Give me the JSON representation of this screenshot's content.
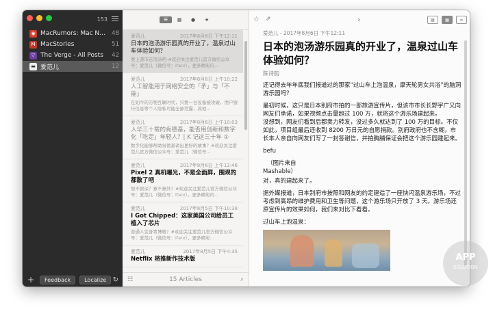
{
  "sidebar": {
    "total_count": "153",
    "feeds": [
      {
        "name": "MacRumors: Mac News a...",
        "count": "48",
        "icon_color": "#d23b2f",
        "icon": "feed-icon"
      },
      {
        "name": "MacStories",
        "count": "51",
        "icon_color": "#c0392b",
        "icon": "feed-icon"
      },
      {
        "name": "The Verge -  All Posts",
        "count": "42",
        "icon_color": "#6c3fa0",
        "icon": "feed-icon"
      },
      {
        "name": "爱范儿",
        "count": "12",
        "icon_color": "#eeeeee",
        "icon": "feed-icon"
      }
    ],
    "feedback_label": "Feedback",
    "localize_label": "Localize"
  },
  "list": {
    "articles": [
      {
        "source": "爱范儿",
        "date": "2017年8月6日 下午12:11",
        "title": "日本的泡汤游乐园真的开业了，温泉过山车体验如何？",
        "summary": "奥上游市吉泡汤吧-#欢迎关注爱范儿官方微信公众号：爱范儿（微信号：ifanr），更多精彩内..."
      },
      {
        "source": "爱范儿",
        "date": "2017年8月6日 上午10:22",
        "title": "人工智能用于网络安全的「矛」与「不能」",
        "summary": "在如今的万物互联时代，只要一台设备被攻破，用户银行信息等个人隐私可能全部泄露，其他..."
      },
      {
        "source": "爱范儿",
        "date": "2017年8月6日 上午10:03",
        "title": "入华三十载的肯德基，能否用创新和数字化「吃定」年轻人？| K 记这三十年 ①",
        "summary": "数字化能够帮助肯德基讲出更好的故事？#欢迎关注爱范儿官方微信公众号：爱范儿（微信号..."
      },
      {
        "source": "爱范儿",
        "date": "2017年8月6日 上午12:46",
        "title": "Pixel 2 真机曝光，不是全面屏，围观的都散了吧",
        "summary": "恨不很深？意不意外？#欢迎关注爱范儿官方微信公众号：爱范儿（微信号：ifanr），更多精彩内..."
      },
      {
        "source": "爱范儿",
        "date": "2017年8月5日 下午10:38",
        "title": "I Got Chipped：这家美国公司给员工植入了芯片",
        "summary": "普通人变身青博格？#欢迎关注爱范儿官方微信公众号：爱范儿（微信号：ifanr），更多精彩..."
      },
      {
        "source": "爱范儿",
        "date": "2017年8月5日 下午4:35",
        "title": "Netflix 将推新作技术版",
        "summary": ""
      }
    ],
    "footer": "15 Articles"
  },
  "reader": {
    "meta": "爱范儿 - 2017年8月6日 下午12:11",
    "title": "日本的泡汤游乐园真的开业了，温泉过山车体验如何？",
    "author": "陈诗韵",
    "paragraphs": [
      "还记得去年年底我们报道过的那家“过山车上泡温泉，摩天轮男女共浴”的脑洞游乐园吗？",
      "最初时候，这只是日本别府市拍的一部旅游宣传片，但该市市长长野宇广又向网友们承诺，如果视频点击量超过 100 万，就将这个游乐场建起来。",
      "没想到，网友们看到后都卖力转发，没过多久就达到了 100 万的目标。不仅如此，项目组最后还收到 8200 万日元的自愿捐款。别府政府也不含糊，市长本人亲自向网友们写了一封答谢信，并拍胸脯保证会把这个游乐园建起来。",
      "befu",
      "（图片来自",
      "Mashable）",
      "对，真的建起来了。",
      "据外媒报道，日本别府市按照和网友的约定建造了一座快闪温泉游乐场，不过考虑到高昂的维护费用和卫生等问题，这个游乐场只开放了 3 天。游乐场还原宣传片的效果如何，我们来对比下看看。",
      "过山车上泡温泉："
    ]
  },
  "watermark": {
    "line1": "APP",
    "line2": "SOLUTION"
  }
}
